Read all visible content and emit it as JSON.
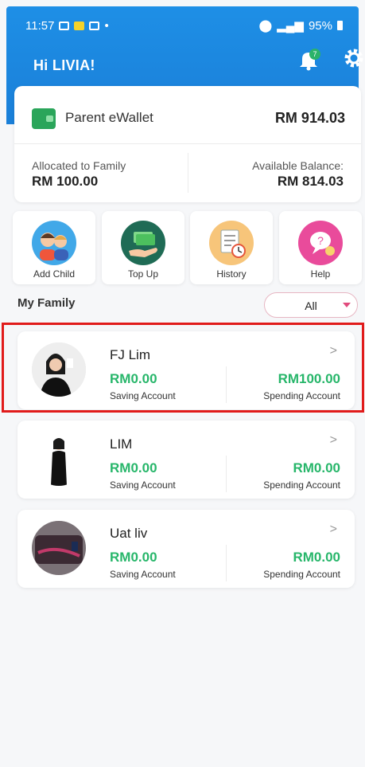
{
  "status_bar": {
    "time": "11:57",
    "battery": "95%"
  },
  "header": {
    "greeting": "Hi LIVIA!",
    "notification_count": "7"
  },
  "wallet": {
    "title": "Parent eWallet",
    "total": "RM 914.03",
    "allocated_label": "Allocated to Family",
    "allocated_value": "RM 100.00",
    "available_label": "Available Balance:",
    "available_value": "RM 814.03"
  },
  "actions": [
    {
      "label": "Add Child",
      "icon": "children-icon",
      "color": "#41a8e8"
    },
    {
      "label": "Top Up",
      "icon": "money-hand-icon",
      "color": "#1f6b55"
    },
    {
      "label": "History",
      "icon": "document-clock-icon",
      "color": "#f7c57a"
    },
    {
      "label": "Help",
      "icon": "help-bubble-icon",
      "color": "#e94b9b"
    }
  ],
  "family": {
    "title": "My Family",
    "filter_value": "All",
    "members": [
      {
        "name": "FJ Lim",
        "saving": "RM0.00",
        "saving_label": "Saving Account",
        "spending": "RM100.00",
        "spending_label": "Spending Account"
      },
      {
        "name": "LIM",
        "saving": "RM0.00",
        "saving_label": "Saving Account",
        "spending": "RM0.00",
        "spending_label": "Spending Account"
      },
      {
        "name": "Uat liv",
        "saving": "RM0.00",
        "saving_label": "Saving Account",
        "spending": "RM0.00",
        "spending_label": "Spending Account"
      }
    ]
  },
  "colors": {
    "header": "#1a7fd8",
    "accent_green": "#27b66a",
    "highlight": "#e11b1b"
  }
}
